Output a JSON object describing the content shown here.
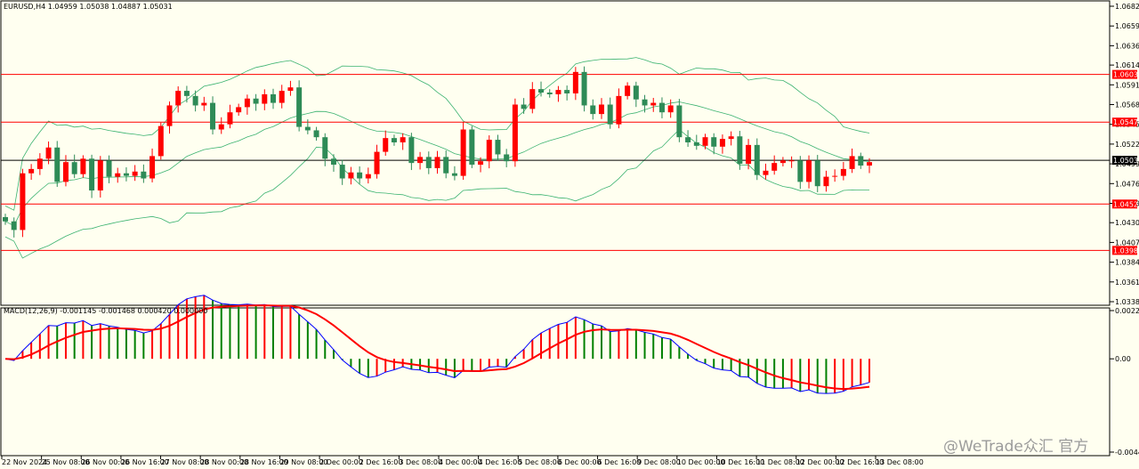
{
  "watermark": "@WeTrade众汇 官方",
  "chart_data": [
    {
      "type": "candlestick",
      "title": "EURUSD,H4  1.04959 1.05038 1.04887 1.05031",
      "yticks": [
        "1.06825",
        "1.06595",
        "1.06365",
        "1.06140",
        "1.05910",
        "1.05680",
        "1.05450",
        "1.05220",
        "1.04990",
        "1.04760",
        "1.04530",
        "1.04305",
        "1.04075",
        "1.03845",
        "1.03615",
        "1.03385"
      ],
      "ylim": [
        1.03385,
        1.06825
      ],
      "xlabels": [
        "22 Nov 2024",
        "25 Nov 08:00",
        "26 Nov 00:00",
        "26 Nov 16:00",
        "27 Nov 08:00",
        "28 Nov 00:00",
        "28 Nov 16:00",
        "29 Nov 08:00",
        "2 Dec 00:00",
        "2 Dec 16:00",
        "3 Dec 08:00",
        "4 Dec 00:00",
        "4 Dec 16:00",
        "5 Dec 08:00",
        "6 Dec 00:00",
        "6 Dec 16:00",
        "9 Dec 08:00",
        "10 Dec 00:00",
        "10 Dec 16:00",
        "11 Dec 08:00",
        "12 Dec 00:00",
        "12 Dec 16:00",
        "13 Dec 08:00"
      ],
      "horizontal_levels": [
        {
          "value": 1.06031,
          "label": "1.06031",
          "color": "#ff0000"
        },
        {
          "value": 1.05476,
          "label": "1.05476",
          "color": "#ff0000"
        },
        {
          "value": 1.05031,
          "label": "1.05031",
          "color": "#000000"
        },
        {
          "value": 1.04522,
          "label": "1.04522",
          "color": "#ff0000"
        },
        {
          "value": 1.03982,
          "label": "1.03982",
          "color": "#ff0000"
        }
      ],
      "series": [
        {
          "name": "close",
          "values": [
            1.0432,
            1.0422,
            1.0488,
            1.0493,
            1.0505,
            1.0518,
            1.0478,
            1.0501,
            1.0487,
            1.0505,
            1.0468,
            1.0503,
            1.0484,
            1.0488,
            1.0485,
            1.049,
            1.0482,
            1.0508,
            1.0543,
            1.0567,
            1.0584,
            1.0578,
            1.0567,
            1.057,
            1.0539,
            1.0545,
            1.0559,
            1.0565,
            1.0575,
            1.0569,
            1.058,
            1.057,
            1.0584,
            1.0588,
            1.0542,
            1.0538,
            1.053,
            1.0505,
            1.0498,
            1.0482,
            1.0489,
            1.0482,
            1.0487,
            1.0513,
            1.0529,
            1.0524,
            1.053,
            1.05,
            1.0507,
            1.0494,
            1.0507,
            1.0488,
            1.0485,
            1.0539,
            1.0498,
            1.0502,
            1.0527,
            1.051,
            1.0502,
            1.0568,
            1.0563,
            1.0586,
            1.0582,
            1.058,
            1.0585,
            1.0581,
            1.0606,
            1.0567,
            1.0557,
            1.0568,
            1.0545,
            1.0578,
            1.059,
            1.0574,
            1.0567,
            1.057,
            1.0559,
            1.0567,
            1.053,
            1.0524,
            1.052,
            1.053,
            1.0519,
            1.0528,
            1.0531,
            1.0499,
            1.0521,
            1.0486,
            1.0491,
            1.05,
            1.0503,
            1.0503,
            1.0478,
            1.0503,
            1.0473,
            1.0484,
            1.0485,
            1.0493,
            1.0508,
            1.0497,
            1.0501
          ]
        }
      ]
    },
    {
      "type": "bar",
      "title": "MACD(12,26,9) -0.001145 -0.001468 0.000420 0.000000",
      "yticks": [
        "0.002294",
        "0.00",
        "-0.004437"
      ],
      "ylim": [
        -0.004437,
        0.002294
      ]
    }
  ]
}
